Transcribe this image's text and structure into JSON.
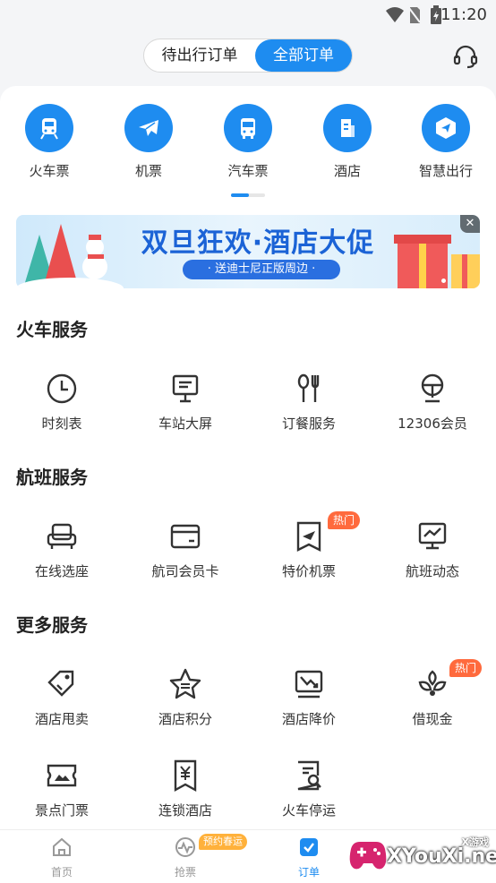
{
  "status_bar": {
    "time": "11:20"
  },
  "header": {
    "tabs": [
      {
        "label": "待出行订单",
        "active": false
      },
      {
        "label": "全部订单",
        "active": true
      }
    ],
    "accent_color": "#1e8cf0"
  },
  "categories": [
    {
      "label": "火车票",
      "icon": "train-icon"
    },
    {
      "label": "机票",
      "icon": "plane-icon"
    },
    {
      "label": "汽车票",
      "icon": "bus-icon"
    },
    {
      "label": "酒店",
      "icon": "hotel-icon"
    },
    {
      "label": "智慧出行",
      "icon": "navigation-icon"
    }
  ],
  "banner": {
    "title": "双旦狂欢·酒店大促",
    "subtitle": "· 送迪士尼正版周边 ·"
  },
  "sections": [
    {
      "title": "火车服务",
      "items": [
        {
          "label": "时刻表",
          "icon": "clock-icon"
        },
        {
          "label": "车站大屏",
          "icon": "screen-icon"
        },
        {
          "label": "订餐服务",
          "icon": "utensils-icon"
        },
        {
          "label": "12306会员",
          "icon": "member-icon"
        }
      ]
    },
    {
      "title": "航班服务",
      "items": [
        {
          "label": "在线选座",
          "icon": "seat-icon"
        },
        {
          "label": "航司会员卡",
          "icon": "card-icon"
        },
        {
          "label": "特价机票",
          "icon": "ticket-plane-icon",
          "badge": "热门"
        },
        {
          "label": "航班动态",
          "icon": "monitor-chart-icon"
        }
      ]
    },
    {
      "title": "更多服务",
      "items": [
        {
          "label": "酒店甩卖",
          "icon": "price-tag-icon"
        },
        {
          "label": "酒店积分",
          "icon": "star-icon"
        },
        {
          "label": "酒店降价",
          "icon": "price-drop-icon"
        },
        {
          "label": "借现金",
          "icon": "leaf-icon",
          "badge": "热门"
        },
        {
          "label": "景点门票",
          "icon": "scenic-ticket-icon"
        },
        {
          "label": "连锁酒店",
          "icon": "yen-bookmark-icon"
        },
        {
          "label": "火车停运",
          "icon": "search-doc-icon"
        }
      ]
    }
  ],
  "tabbar": {
    "items": [
      {
        "label": "首页",
        "icon": "home-icon",
        "active": false
      },
      {
        "label": "抢票",
        "icon": "pulse-icon",
        "active": false,
        "badge": "预约春运"
      },
      {
        "label": "订单",
        "icon": "check-icon",
        "active": true
      }
    ]
  },
  "watermark": {
    "text": "XYouXi.net",
    "small": "X游戏"
  }
}
